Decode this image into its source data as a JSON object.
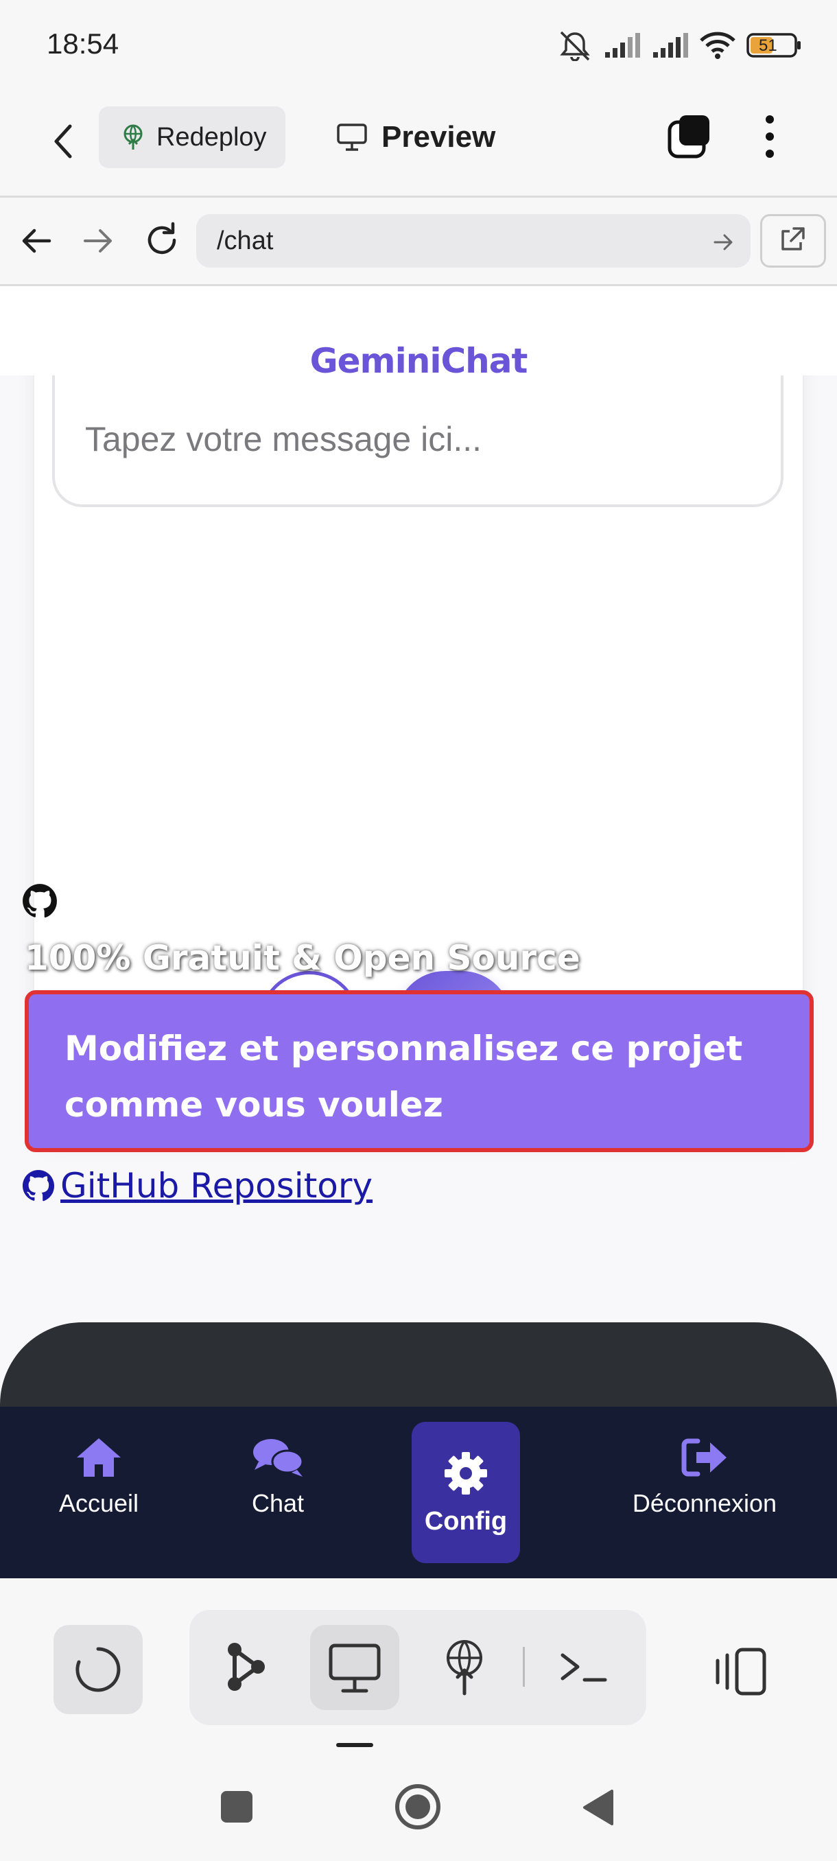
{
  "status_bar": {
    "time": "18:54",
    "battery": "51"
  },
  "app_bar": {
    "redeploy_label": "Redeploy",
    "preview_label": "Preview"
  },
  "browser": {
    "url": "/chat"
  },
  "site": {
    "title": "GeminiChat",
    "input_placeholder": "Tapez votre message ici...",
    "free_text": "100% Gratuit & Open Source",
    "customize_text": "Modifiez et personnalisez ce projet comme vous voulez",
    "github_link": "GitHub Repository"
  },
  "bottom_nav": {
    "items": [
      {
        "label": "Accueil",
        "icon": "home-icon"
      },
      {
        "label": "Chat",
        "icon": "chat-icon"
      },
      {
        "label": "Config",
        "icon": "gear-icon"
      },
      {
        "label": "Déconnexion",
        "icon": "logout-icon"
      }
    ]
  },
  "colors": {
    "brand": "#6a55d8",
    "customize_bg": "#8f6eef",
    "highlight_border": "#e03232",
    "nav_bg": "#151b33",
    "nav_active": "#3b30a0"
  }
}
